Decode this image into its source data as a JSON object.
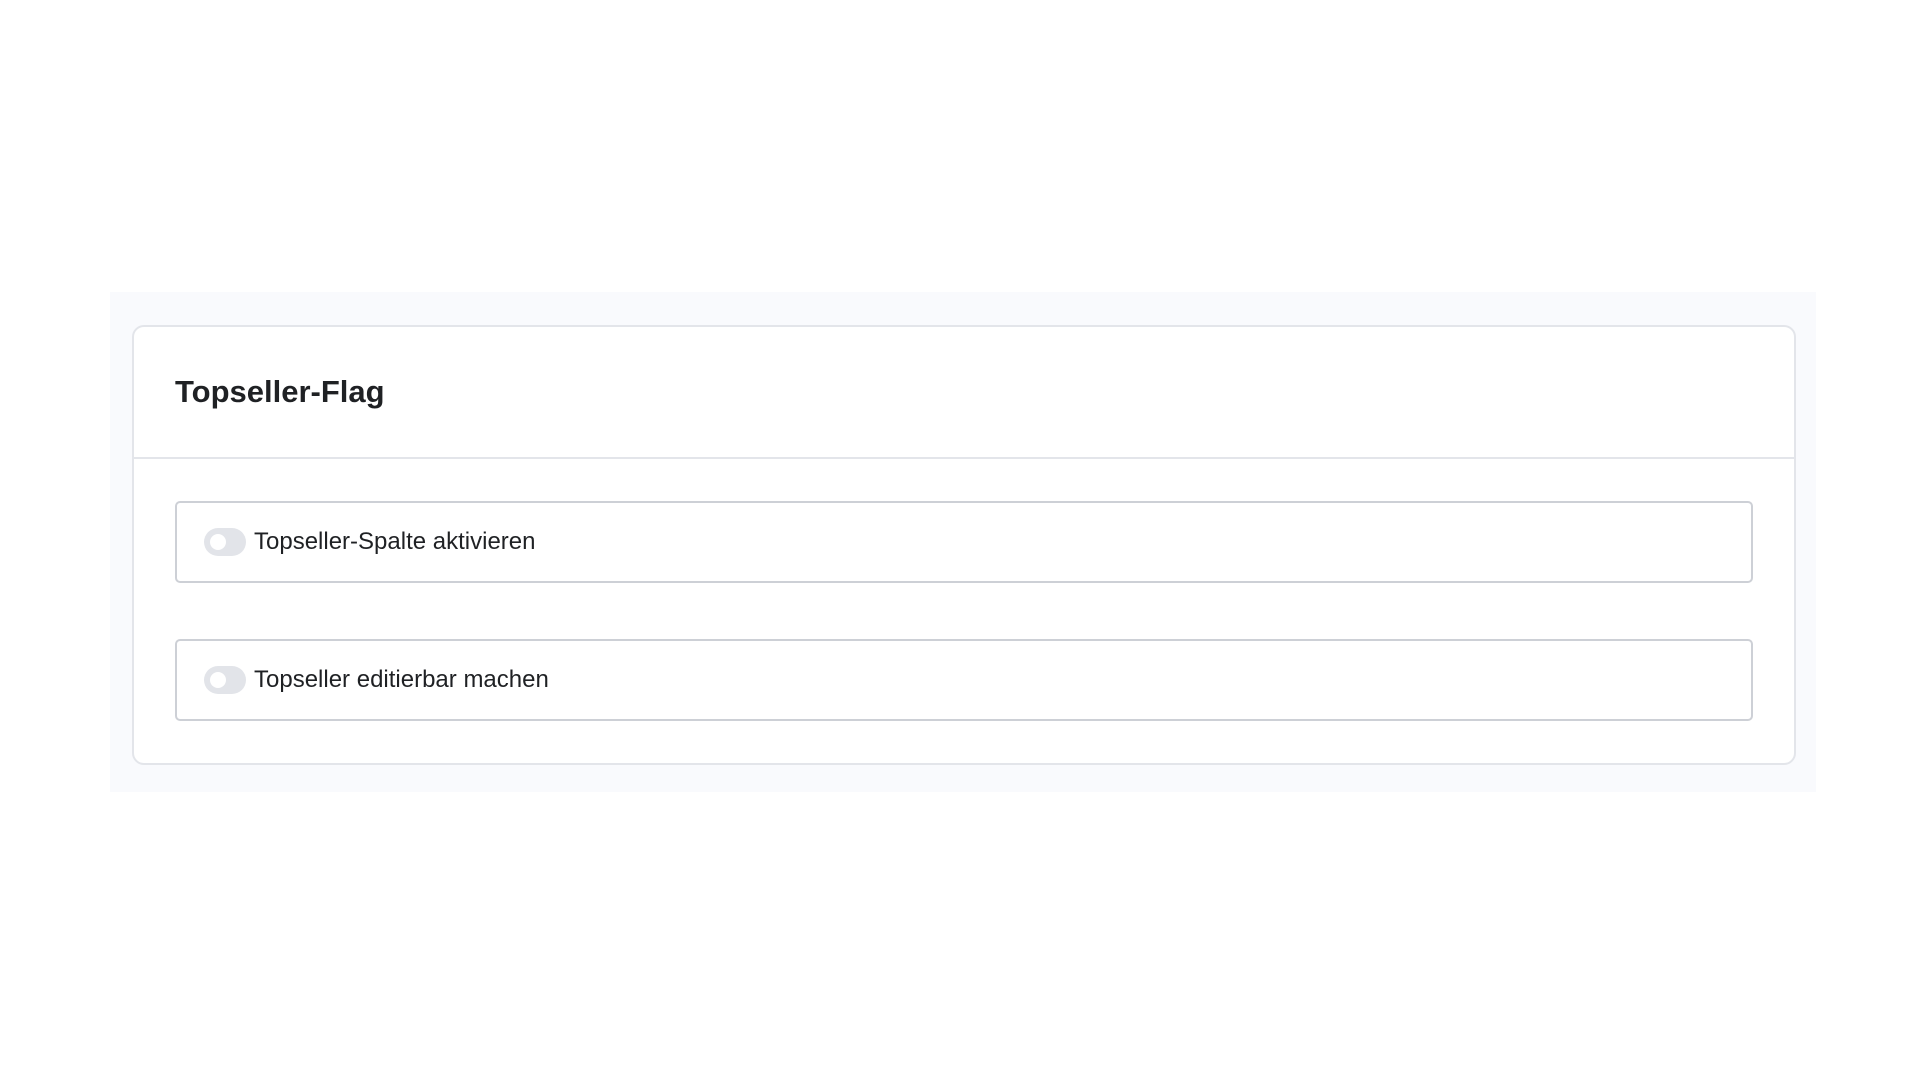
{
  "card": {
    "title": "Topseller-Flag"
  },
  "options": [
    {
      "label": "Topseller-Spalte aktivieren",
      "enabled": false
    },
    {
      "label": "Topseller editierbar machen",
      "enabled": false
    }
  ],
  "colors": {
    "toggle_off": "#e2e4e9",
    "border": "#cdd0d6",
    "text": "#1f2124"
  }
}
